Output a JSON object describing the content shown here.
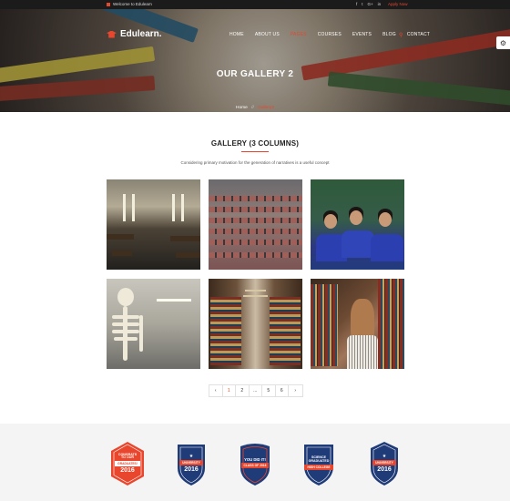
{
  "topbar": {
    "welcome": "Welcome to Edulearn",
    "social_icons": [
      "facebook-icon",
      "twitter-icon",
      "google-plus-icon",
      "linkedin-icon"
    ],
    "social_glyphs": [
      "f",
      "t",
      "G+",
      "in"
    ],
    "apply": "Apply Now"
  },
  "header": {
    "logo": "Edulearn.",
    "nav": [
      "HOME",
      "ABOUT US",
      "PAGES",
      "COURSES",
      "EVENTS",
      "BLOG",
      "CONTACT"
    ],
    "active_nav": "PAGES",
    "search_glyph": "⚲"
  },
  "hero": {
    "title": "OUR GALLERY 2",
    "breadcrumb": [
      "Home",
      "Gallery2"
    ],
    "breadcrumb_sep": "//"
  },
  "gallery": {
    "title": "GALLERY (3 COLUMNS)",
    "subtitle": "Considering primary motivation for the generation of narratives is a useful concept",
    "photos": [
      "laboratory",
      "auditorium",
      "students",
      "skeleton",
      "library-aisle",
      "girl-in-library"
    ]
  },
  "pagination": {
    "items": [
      "‹",
      "1",
      "2",
      "...",
      "5",
      "6",
      "›"
    ],
    "current": "1"
  },
  "badges": [
    {
      "lines": [
        "CONGRATS",
        "TO OUR"
      ],
      "ribbon": "GRADUATES!",
      "year": "2016",
      "color": "#e8472d"
    },
    {
      "lines": [
        "★"
      ],
      "ribbon": "UNIVERSITY",
      "year": "2016",
      "color": "#1f3b78"
    },
    {
      "lines": [
        "YOU DID IT!"
      ],
      "ribbon": "CLASS OF 2016",
      "year": "",
      "color": "#1f3b78"
    },
    {
      "lines": [
        "SCIENCE",
        "GRADUATED"
      ],
      "ribbon": "HIGH COLLEGE",
      "year": "",
      "color": "#1f3b78"
    },
    {
      "lines": [
        "★"
      ],
      "ribbon": "UNIVERSITY",
      "year": "2016",
      "color": "#1f3b78"
    }
  ],
  "colors": {
    "accent": "#e8472d",
    "navy": "#1f3b78",
    "topbar": "#1b1b1b"
  }
}
